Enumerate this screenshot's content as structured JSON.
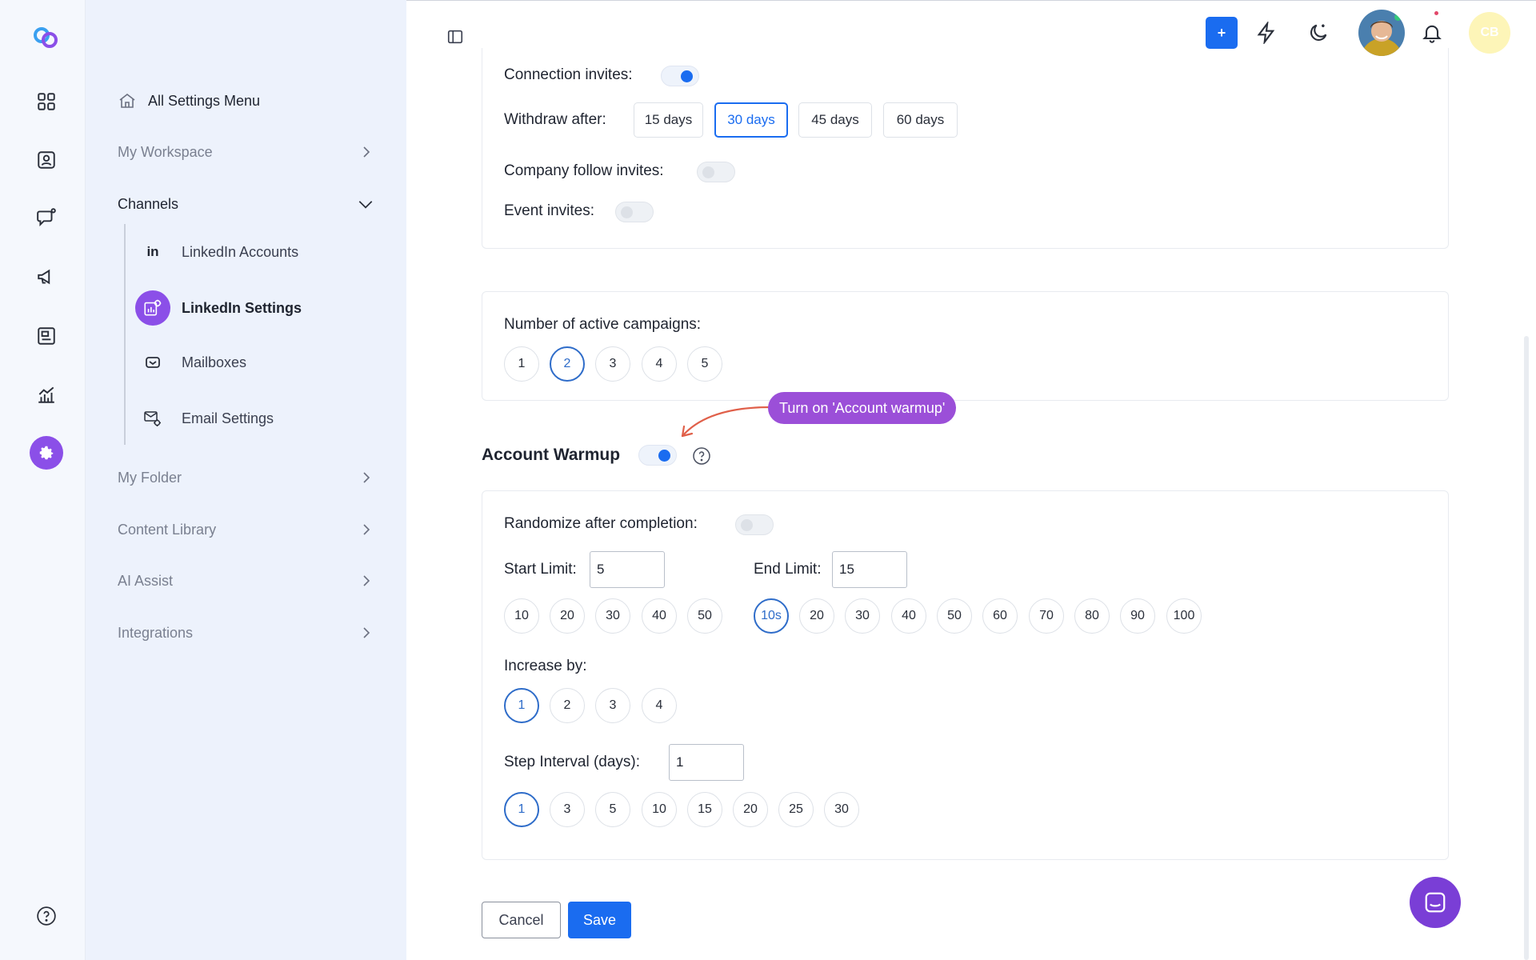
{
  "sidebar": {
    "home_label": "All Settings Menu",
    "sections": [
      {
        "label": "My Workspace"
      },
      {
        "label": "Channels"
      },
      {
        "label": "My Folder"
      },
      {
        "label": "Content Library"
      },
      {
        "label": "AI Assist"
      },
      {
        "label": "Integrations"
      }
    ],
    "channel_items": [
      {
        "label": "LinkedIn Accounts",
        "icon": "linkedin-icon",
        "icon_text": "in"
      },
      {
        "label": "LinkedIn Settings",
        "icon": "settings-chart-icon",
        "active": true
      },
      {
        "label": "Mailboxes",
        "icon": "mailbox-icon"
      },
      {
        "label": "Email Settings",
        "icon": "email-settings-icon"
      }
    ]
  },
  "header": {
    "plus_label": "+",
    "user_initials": "CB"
  },
  "invites": {
    "connection_label": "Connection invites:",
    "withdraw_label": "Withdraw after:",
    "withdraw_options": [
      "15 days",
      "30 days",
      "45 days",
      "60 days"
    ],
    "withdraw_selected": "30 days",
    "company_label": "Company follow invites:",
    "event_label": "Event invites:"
  },
  "campaigns": {
    "label": "Number of active campaigns:",
    "options": [
      "1",
      "2",
      "3",
      "4",
      "5"
    ],
    "selected": "2"
  },
  "callout": {
    "text": "Turn on 'Account warmup'"
  },
  "warmup": {
    "title": "Account Warmup",
    "randomize_label": "Randomize after completion:",
    "start_limit_label": "Start Limit:",
    "start_limit_value": "5",
    "end_limit_label": "End Limit:",
    "end_limit_value": "15",
    "start_options": [
      "10",
      "20",
      "30",
      "40",
      "50"
    ],
    "end_options": [
      "10s",
      "20",
      "30",
      "40",
      "50",
      "60",
      "70",
      "80",
      "90",
      "100"
    ],
    "end_selected": "10s",
    "increase_label": "Increase by:",
    "increase_options": [
      "1",
      "2",
      "3",
      "4"
    ],
    "increase_selected": "1",
    "step_label": "Step Interval (days):",
    "step_value": "1",
    "step_options": [
      "1",
      "3",
      "5",
      "10",
      "15",
      "20",
      "25",
      "30"
    ],
    "step_selected": "1"
  },
  "actions": {
    "cancel_label": "Cancel",
    "save_label": "Save"
  },
  "colors": {
    "accent_blue": "#1a6cf0",
    "accent_purple": "#8b4fe8",
    "callout_purple": "#9b4fd8",
    "sidebar_bg": "#edf2fc"
  }
}
